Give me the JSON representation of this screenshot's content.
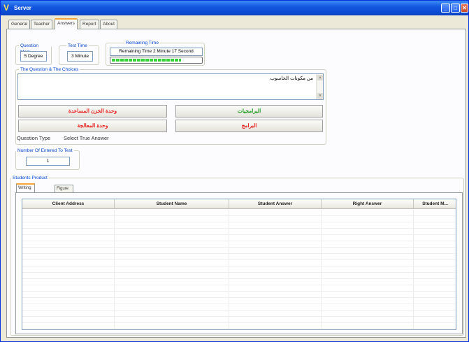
{
  "window": {
    "title": "Server",
    "minimize_label": "_",
    "maximize_label": "□",
    "close_label": "✕",
    "app_icon": "V"
  },
  "tabs": [
    {
      "label": "General"
    },
    {
      "label": "Teacher"
    },
    {
      "label": "Answers"
    },
    {
      "label": "Report"
    },
    {
      "label": "About Me"
    }
  ],
  "question_mark": {
    "label": "Question Mark",
    "value": "5 Degree"
  },
  "test_time": {
    "label": "Test Time",
    "value": "3 Minute"
  },
  "remaining_time": {
    "label": "Remaining Time",
    "text": "Remaining Time  2 Minute  17 Second",
    "progress_fraction": 0.78
  },
  "question": {
    "label": "The Question & The Choices",
    "text": "من مكونات الحاسوب",
    "choices": [
      {
        "text": "وحدة الخزن المساعدة",
        "color": "#e82020"
      },
      {
        "text": "البرامجيات",
        "color": "#1a9a1a"
      },
      {
        "text": "وحدة المعالجة",
        "color": "#e82020"
      },
      {
        "text": "البرامج",
        "color": "#e82020"
      }
    ],
    "type_label": "Question Type",
    "type_value": "Select True Answer"
  },
  "entered": {
    "label": "Number Of Entered To Test",
    "value": "1"
  },
  "students_product": {
    "label": "Students Product",
    "tabs": [
      {
        "label": "Writing Product"
      },
      {
        "label": "Figure Product"
      }
    ],
    "columns": [
      {
        "label": "Client Address"
      },
      {
        "label": "Student Name"
      },
      {
        "label": "Student Answer"
      },
      {
        "label": "Right Answer"
      },
      {
        "label": "Student M..."
      }
    ]
  },
  "colors": {
    "titlebar": "#0a48cf",
    "group_label": "#0046d5",
    "progress": "#37d139",
    "active_tab_accent": "#f3a536"
  }
}
